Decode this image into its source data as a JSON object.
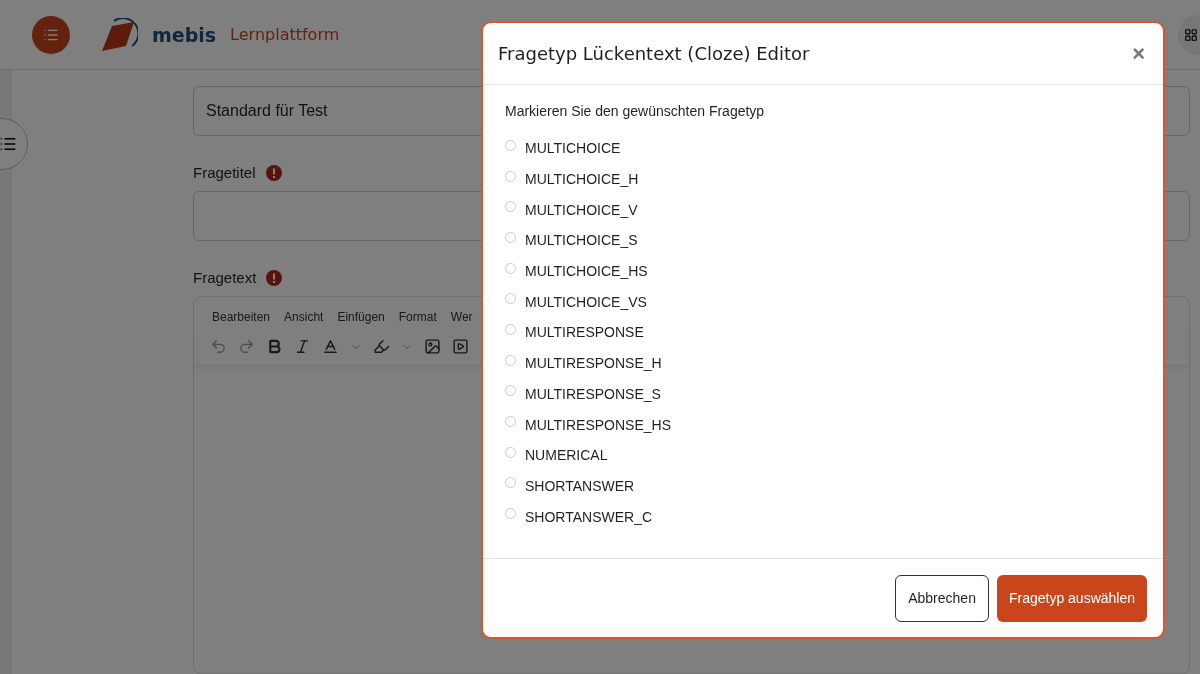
{
  "header": {
    "brand": "mebis",
    "product": "Lernplattform"
  },
  "form": {
    "category_value": "Standard für Test",
    "fields": [
      {
        "label": "Fragetitel",
        "required": true
      },
      {
        "label": "Fragetext",
        "required": true
      }
    ],
    "editor": {
      "menu": [
        "Bearbeiten",
        "Ansicht",
        "Einfügen",
        "Format",
        "Wer"
      ]
    }
  },
  "dialog": {
    "title": "Fragetyp Lückentext (Cloze) Editor",
    "close": "×",
    "instruction": "Markieren Sie den gewünschten Fragetyp",
    "options": [
      {
        "label": "MULTICHOICE",
        "selected": false
      },
      {
        "label": "MULTICHOICE_H",
        "selected": false
      },
      {
        "label": "MULTICHOICE_V",
        "selected": false
      },
      {
        "label": "MULTICHOICE_S",
        "selected": false
      },
      {
        "label": "MULTICHOICE_HS",
        "selected": false
      },
      {
        "label": "MULTICHOICE_VS",
        "selected": false
      },
      {
        "label": "MULTIRESPONSE",
        "selected": false
      },
      {
        "label": "MULTIRESPONSE_H",
        "selected": false
      },
      {
        "label": "MULTIRESPONSE_S",
        "selected": false
      },
      {
        "label": "MULTIRESPONSE_HS",
        "selected": false
      },
      {
        "label": "NUMERICAL",
        "selected": false
      },
      {
        "label": "SHORTANSWER",
        "selected": false
      },
      {
        "label": "SHORTANSWER_C",
        "selected": false
      }
    ],
    "buttons": [
      {
        "label": "Abbrechen",
        "kind": "secondary"
      },
      {
        "label": "Fragetyp auswählen",
        "kind": "primary"
      }
    ]
  }
}
